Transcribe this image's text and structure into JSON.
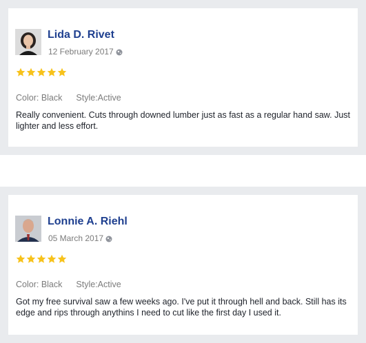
{
  "reviews": [
    {
      "name": "Lida D. Rivet",
      "date": "12 February 2017",
      "rating": 5,
      "color": "Color: Black",
      "style": "Style:Active",
      "text": "Really convenient. Cuts through downed lumber just as fast as a regular hand saw. Just lighter and less effort."
    },
    {
      "name": "Lonnie A. Riehl",
      "date": "05 March 2017",
      "rating": 5,
      "color": "Color: Black",
      "style": "Style:Active",
      "text": "Got my free survival saw a few weeks ago. I've put it through hell and back. Still has its edge and rips through anythins I need to cut like the first day I used it."
    }
  ],
  "colors": {
    "name": "#1e3f8f",
    "star": "#f7c21b",
    "muted": "#7b7b7b",
    "frame": "#e9ebee"
  },
  "icons": {
    "visibility": "globe-icon",
    "rating": "star-icon"
  }
}
